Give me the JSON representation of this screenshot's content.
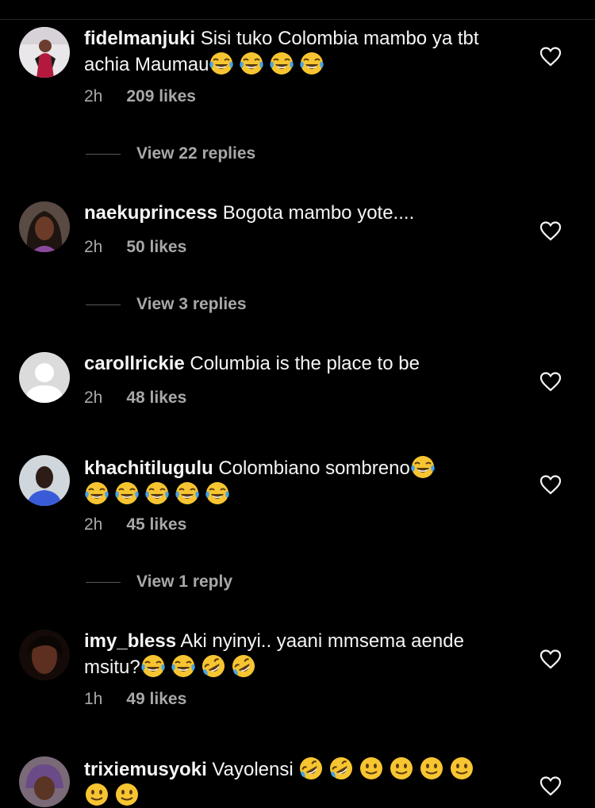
{
  "comments": [
    {
      "username": "fidelmanjuki",
      "text": "Sisi tuko Colombia mambo ya tbt achia Maumau",
      "emojis": [
        "tears-of-joy",
        "tears-of-joy",
        "tears-of-joy",
        "tears-of-joy"
      ],
      "time": "2h",
      "likes": "209 likes",
      "replies": "View 22 replies"
    },
    {
      "username": "naekuprincess",
      "text": "Bogota mambo yote....",
      "emojis": [],
      "time": "2h",
      "likes": "50 likes",
      "replies": "View 3 replies"
    },
    {
      "username": "carollrickie",
      "text": "Columbia is the place to be",
      "emojis": [],
      "time": "2h",
      "likes": "48 likes"
    },
    {
      "username": "khachitilugulu",
      "text": "Colombiano sombreno",
      "emojis": [
        "tears-of-joy",
        "tears-of-joy",
        "tears-of-joy",
        "tears-of-joy",
        "tears-of-joy",
        "tears-of-joy"
      ],
      "time": "2h",
      "likes": "45 likes",
      "replies": "View 1 reply"
    },
    {
      "username": "imy_bless",
      "text": "Aki nyinyi.. yaani mmsema aende msitu?",
      "emojis": [
        "tears-of-joy",
        "tears-of-joy",
        "rolling-on-floor-laughing",
        "rolling-on-floor-laughing"
      ],
      "time": "1h",
      "likes": "49 likes"
    },
    {
      "username": "trixiemusyoki",
      "text": "Vayolensi",
      "emojis": [
        "rolling-on-floor-laughing",
        "rolling-on-floor-laughing",
        "slightly-smiling-face",
        "slightly-smiling-face",
        "slightly-smiling-face",
        "slightly-smiling-face",
        "slightly-smiling-face",
        "slightly-smiling-face"
      ]
    }
  ],
  "colors": {
    "background": "#000000",
    "primary_text": "#f5f5f5",
    "secondary_text": "#a8a8a8",
    "emoji_yellow": "#f7c531"
  }
}
